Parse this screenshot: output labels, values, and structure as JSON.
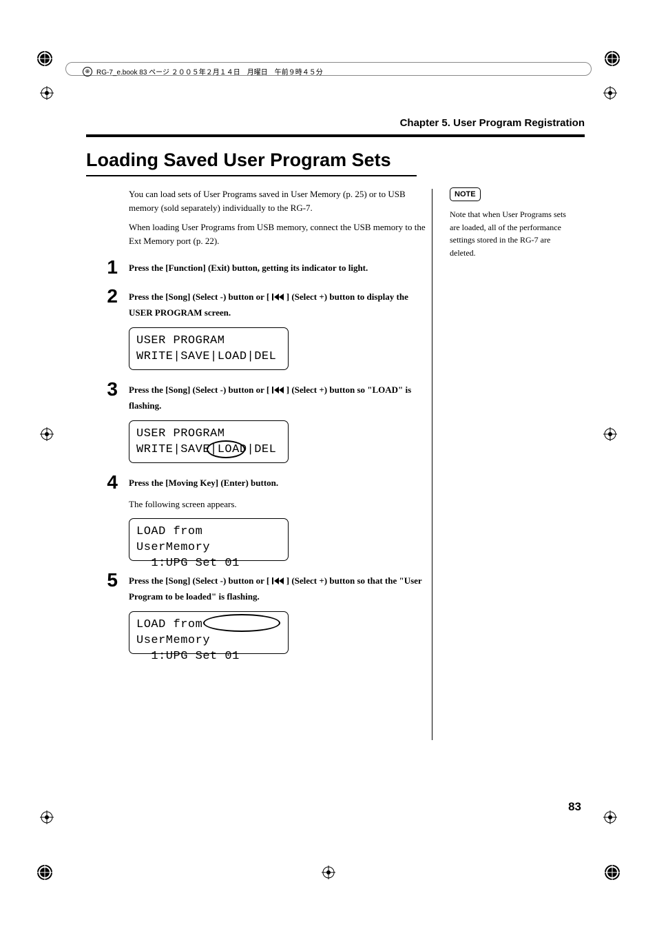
{
  "header": {
    "book_info": "RG-7_e.book 83 ページ ２００５年２月１４日　月曜日　午前９時４５分"
  },
  "chapter": {
    "label": "Chapter 5. User Program Registration"
  },
  "section": {
    "title": "Loading Saved User Program Sets",
    "intro1": "You can load sets of User Programs saved in User Memory (p. 25) or to USB memory (sold separately) individually to the RG-7.",
    "intro2": "When loading User Programs from USB memory, connect the USB memory to the Ext Memory port (p. 22)."
  },
  "steps": {
    "s1": {
      "num": "1",
      "text": "Press the [Function] (Exit) button, getting its indicator to light."
    },
    "s2": {
      "num": "2",
      "text_a": "Press the [Song] (Select -) button or [ ",
      "text_b": " ] (Select +) button to display the USER PROGRAM screen."
    },
    "s3": {
      "num": "3",
      "text_a": "Press the [Song] (Select -) button or [ ",
      "text_b": " ] (Select +) button so \"LOAD\" is flashing."
    },
    "s4": {
      "num": "4",
      "text": "Press the [Moving Key] (Enter) button.",
      "sub": "The following screen appears."
    },
    "s5": {
      "num": "5",
      "text_a": "Press the [Song] (Select -) button or [ ",
      "text_b": " ] (Select +) button so that the \"User Program to be loaded\" is flashing."
    }
  },
  "lcd": {
    "screen1_l1": "USER PROGRAM",
    "screen1_l2": "WRITE|SAVE|LOAD|DEL",
    "screen2_l1": "USER PROGRAM",
    "screen2_l2": "WRITE|SAVE|LOAD|DEL",
    "screen3_l1": "LOAD from UserMemory",
    "screen3_l2": "  1:UPG Set 01",
    "screen4_l1": "LOAD from UserMemory",
    "screen4_l2": "  1:UPG Set 01"
  },
  "note": {
    "label": "NOTE",
    "text": "Note that when User Programs sets are loaded, all of the performance settings stored in the RG-7 are deleted."
  },
  "page": {
    "number": "83"
  }
}
